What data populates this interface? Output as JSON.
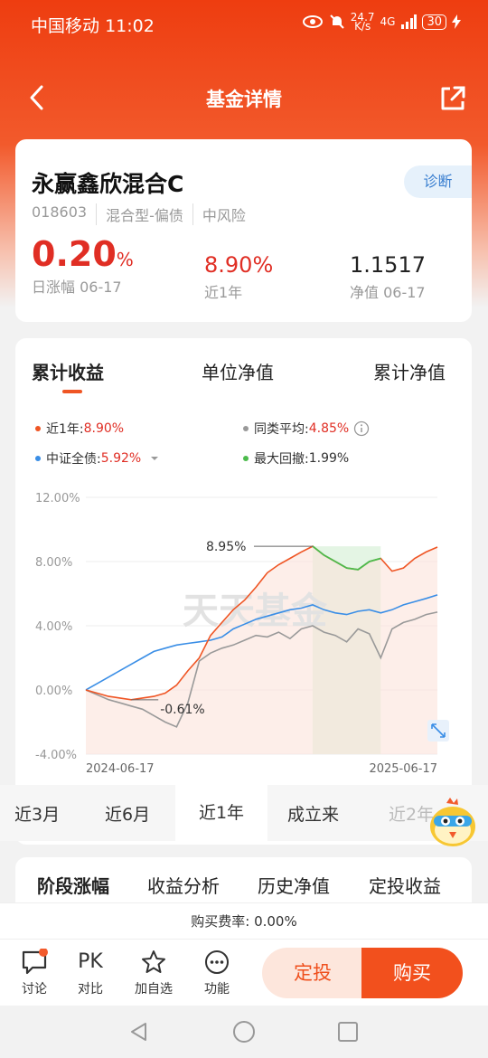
{
  "status": {
    "carrier": "中国移动",
    "time": "11:02",
    "speed": "24.7",
    "speed_unit": "K/s",
    "network": "4G",
    "battery": "30"
  },
  "nav": {
    "title": "基金详情",
    "back_icon": "back-arrow-icon",
    "share_icon": "share-icon"
  },
  "fund": {
    "name": "永赢鑫欣混合C",
    "diagnose_label": "诊断",
    "code": "018603",
    "type": "混合型-偏债",
    "risk": "中风险",
    "daily_change": "0.20",
    "daily_change_unit": "%",
    "daily_change_label": "日涨幅 06-17",
    "year_return": "8.90%",
    "year_return_label": "近1年",
    "nav_value": "1.1517",
    "nav_label": "净值 06-17"
  },
  "chart_tabs": [
    "累计收益",
    "单位净值",
    "累计净值"
  ],
  "legend": {
    "fund": {
      "label": "近1年:",
      "value": "8.90%",
      "color": "#ef5524"
    },
    "peer": {
      "label": "同类平均:",
      "value": "4.85%",
      "color": "#999999"
    },
    "index": {
      "label": "中证全债:",
      "value": "5.92%",
      "color": "#3a8ee6"
    },
    "drawdown": {
      "label": "最大回撤:",
      "value": "1.99%",
      "color": "#4cbb4c"
    }
  },
  "chart_data": {
    "type": "line",
    "yticks": [
      "12.00%",
      "8.00%",
      "4.00%",
      "0.00%",
      "-4.00%"
    ],
    "ylim": [
      -4,
      12
    ],
    "x_start": "2024-06-17",
    "x_end": "2025-06-17",
    "watermark": "天天基金",
    "annotations": {
      "max": "8.95%",
      "min": "-0.61%"
    },
    "series": [
      {
        "name": "近1年",
        "color": "#ef5524",
        "values": [
          0.0,
          -0.2,
          -0.4,
          -0.5,
          -0.61,
          -0.5,
          -0.4,
          -0.2,
          0.3,
          1.2,
          2.0,
          3.4,
          4.2,
          5.0,
          5.6,
          6.4,
          7.3,
          7.8,
          8.2,
          8.6,
          8.95,
          8.4,
          8.0,
          7.6,
          7.5,
          8.0,
          8.2,
          7.4,
          7.6,
          8.2,
          8.6,
          8.9
        ]
      },
      {
        "name": "同类平均",
        "color": "#999999",
        "values": [
          0.0,
          -0.3,
          -0.6,
          -0.8,
          -1.0,
          -1.2,
          -1.6,
          -2.0,
          -2.3,
          -0.8,
          1.8,
          2.3,
          2.6,
          2.8,
          3.1,
          3.4,
          3.3,
          3.6,
          3.2,
          3.8,
          4.0,
          3.6,
          3.4,
          3.0,
          3.8,
          3.5,
          2.0,
          3.8,
          4.2,
          4.4,
          4.7,
          4.85
        ]
      },
      {
        "name": "中证全债",
        "color": "#3a8ee6",
        "values": [
          0.0,
          0.4,
          0.8,
          1.2,
          1.6,
          2.0,
          2.4,
          2.6,
          2.8,
          2.9,
          3.0,
          3.1,
          3.3,
          3.8,
          4.1,
          4.4,
          4.6,
          4.8,
          5.0,
          5.1,
          5.3,
          5.0,
          4.8,
          4.7,
          4.9,
          5.0,
          4.8,
          5.0,
          5.3,
          5.5,
          5.7,
          5.92
        ]
      }
    ],
    "drawdown_window": [
      20,
      26
    ]
  },
  "ranges": [
    "近3月",
    "近6月",
    "近1年",
    "成立来",
    "近2年"
  ],
  "stage_tabs": [
    "阶段涨幅",
    "收益分析",
    "历史净值",
    "定投收益"
  ],
  "fee_text": "购买费率: 0.00%",
  "toolbar": {
    "discuss": "讨论",
    "compare_top": "PK",
    "compare": "对比",
    "favorite": "加自选",
    "functions": "功能",
    "auto_invest": "定投",
    "buy": "购买"
  }
}
